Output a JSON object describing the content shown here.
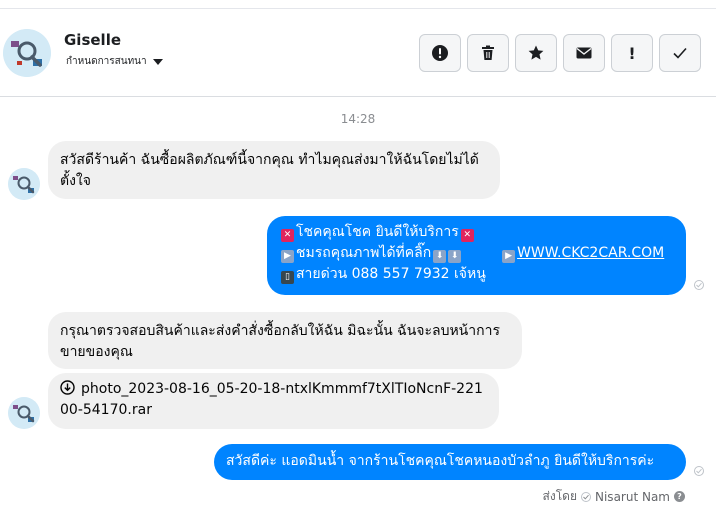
{
  "header": {
    "contact_name": "Giselle",
    "convo_menu_label": "กำหนดการสนทนา"
  },
  "actions": [
    {
      "icon": "exclamation-circle-icon"
    },
    {
      "icon": "trash-icon"
    },
    {
      "icon": "star-icon"
    },
    {
      "icon": "envelope-icon"
    },
    {
      "icon": "exclamation-icon",
      "glyph": "!"
    },
    {
      "icon": "checkmark-icon"
    }
  ],
  "thread": {
    "timestamp": "14:28",
    "messages": [
      {
        "direction": "incoming",
        "text": "สวัสดีร้านค้า ฉันซื้อผลิตภัณฑ์นี้จากคุณ ทำไมคุณส่งมาให้ฉันโดยไม่ได้ตั้งใจ"
      },
      {
        "direction": "outgoing",
        "line1": "โชคคุณโชค ยินดีให้บริการ",
        "line2": "ชมรถคุณภาพได้ที่คลิ๊ก",
        "link": "WWW.CKC2CAR.COM",
        "line3": "สายด่วน 088 557 7932 เจ้หนู"
      },
      {
        "direction": "incoming",
        "text": "กรุณาตรวจสอบสินค้าและส่งคำสั่งซื้อกลับให้ฉัน มิฉะนั้น ฉันจะลบหน้าการขายของคุณ"
      },
      {
        "direction": "incoming",
        "file_name": "photo_2023-08-16_05-20-18-ntxlKmmmf7tXlTIoNcnF-22100-54170.rar"
      },
      {
        "direction": "outgoing",
        "text": "สวัสดีค่ะ แอดมินน้ำ จากร้านโชคคุณโชคหนองบัวลำภู ยินดีให้บริการค่ะ"
      }
    ]
  },
  "footer": {
    "sent_by_label": "ส่งโดย",
    "sender_name": "Nisarut Nam"
  },
  "colors": {
    "outgoing_bubble": "#0084ff",
    "incoming_bubble": "#f0f0f0"
  }
}
